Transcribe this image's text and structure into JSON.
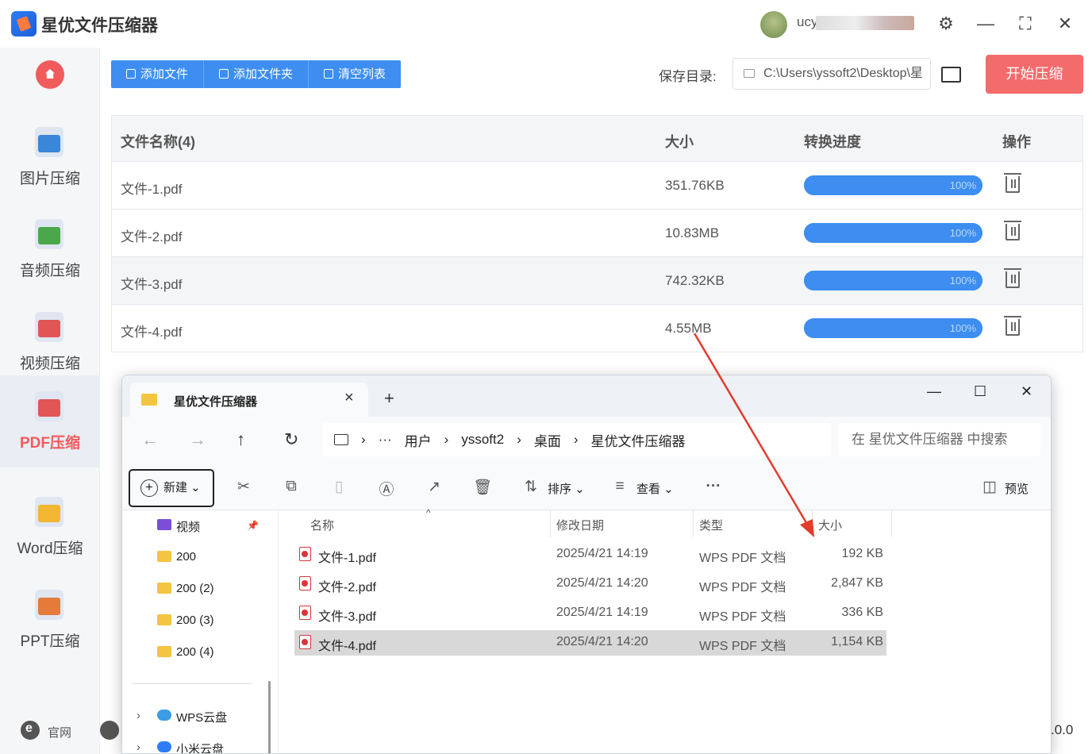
{
  "app": {
    "title": "星优文件压缩器",
    "username": "ucy",
    "version": ".0.0",
    "footer_link": "官网"
  },
  "sidebar": {
    "items": [
      {
        "label": "图片压缩",
        "icon": "image-icon",
        "color": "#3a86d8"
      },
      {
        "label": "音频压缩",
        "icon": "music-icon",
        "color": "#4aa84a"
      },
      {
        "label": "视频压缩",
        "icon": "video-icon",
        "color": "#e25555"
      },
      {
        "label": "PDF压缩",
        "icon": "pdf-icon",
        "color": "#e25555"
      },
      {
        "label": "Word压缩",
        "icon": "word-icon",
        "color": "#f2b632"
      },
      {
        "label": "PPT压缩",
        "icon": "ppt-icon",
        "color": "#e57b3a"
      }
    ],
    "active": "PDF压缩"
  },
  "toolbar": {
    "add_file": "添加文件",
    "add_folder": "添加文件夹",
    "clear_list": "清空列表"
  },
  "save": {
    "label": "保存目录:",
    "path": "C:\\Users\\yssoft2\\Desktop\\星",
    "start_button": "开始压缩"
  },
  "table": {
    "headers": {
      "name": "文件名称(4)",
      "size": "大小",
      "progress": "转换进度",
      "action": "操作"
    },
    "rows": [
      {
        "name": "文件-1.pdf",
        "size": "351.76KB",
        "progress": 100,
        "progress_label": "100%"
      },
      {
        "name": "文件-2.pdf",
        "size": "10.83MB",
        "progress": 100,
        "progress_label": "100%"
      },
      {
        "name": "文件-3.pdf",
        "size": "742.32KB",
        "progress": 100,
        "progress_label": "100%"
      },
      {
        "name": "文件-4.pdf",
        "size": "4.55MB",
        "progress": 100,
        "progress_label": "100%"
      }
    ]
  },
  "explorer": {
    "tab_title": "星优文件压缩器",
    "breadcrumb": [
      "用户",
      "yssoft2",
      "桌面",
      "星优文件压缩器"
    ],
    "search_placeholder": "在 星优文件压缩器 中搜索",
    "commands": {
      "new": "新建",
      "sort": "排序",
      "view": "查看",
      "preview": "预览"
    },
    "nav": [
      {
        "label": "视频",
        "icon": "video-folder-icon"
      },
      {
        "label": "200",
        "icon": "folder-icon"
      },
      {
        "label": "200 (2)",
        "icon": "folder-icon"
      },
      {
        "label": "200 (3)",
        "icon": "folder-icon"
      },
      {
        "label": "200 (4)",
        "icon": "folder-icon"
      },
      {
        "label": "WPS云盘",
        "icon": "cloud-icon"
      },
      {
        "label": "小米云盘",
        "icon": "cloud-icon"
      }
    ],
    "columns": {
      "name": "名称",
      "date": "修改日期",
      "type": "类型",
      "size": "大小"
    },
    "files": [
      {
        "name": "文件-1.pdf",
        "date": "2025/4/21 14:19",
        "type": "WPS PDF 文档",
        "size": "192 KB"
      },
      {
        "name": "文件-2.pdf",
        "date": "2025/4/21 14:20",
        "type": "WPS PDF 文档",
        "size": "2,847 KB"
      },
      {
        "name": "文件-3.pdf",
        "date": "2025/4/21 14:19",
        "type": "WPS PDF 文档",
        "size": "336 KB"
      },
      {
        "name": "文件-4.pdf",
        "date": "2025/4/21 14:20",
        "type": "WPS PDF 文档",
        "size": "1,154 KB"
      }
    ],
    "selected_file": "文件-4.pdf"
  },
  "annotation": {
    "color": "#e33b2e"
  }
}
